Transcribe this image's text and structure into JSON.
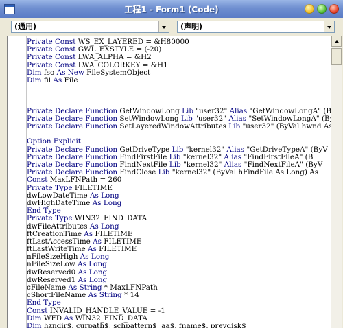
{
  "window": {
    "title": "工程1 - Form1 (Code)"
  },
  "combos": {
    "object": "(通用)",
    "procedure": "(声明)"
  },
  "code": [
    [
      {
        "t": "Private Const",
        "k": 1
      },
      {
        "t": " WS_EX_LAYERED = &H80000"
      }
    ],
    [
      {
        "t": "Private Const",
        "k": 1
      },
      {
        "t": " GWL_EXSTYLE = (-20)"
      }
    ],
    [
      {
        "t": "Private Const",
        "k": 1
      },
      {
        "t": " LWA_ALPHA = &H2"
      }
    ],
    [
      {
        "t": "Private Const",
        "k": 1
      },
      {
        "t": " LWA_COLORKEY = &H1"
      }
    ],
    [
      {
        "t": "Dim",
        "k": 1
      },
      {
        "t": " fso "
      },
      {
        "t": "As New",
        "k": 1
      },
      {
        "t": " FileSystemObject"
      }
    ],
    [
      {
        "t": "Dim",
        "k": 1
      },
      {
        "t": " fil "
      },
      {
        "t": "As",
        "k": 1
      },
      {
        "t": " File"
      }
    ],
    [],
    [],
    [],
    [
      {
        "t": "Private Declare Function",
        "k": 1
      },
      {
        "t": " GetWindowLong "
      },
      {
        "t": "Lib",
        "k": 1
      },
      {
        "t": " \"user32\" "
      },
      {
        "t": "Alias",
        "k": 1
      },
      {
        "t": " \"GetWindowLongA\" (ByV"
      }
    ],
    [
      {
        "t": "Private Declare Function",
        "k": 1
      },
      {
        "t": " SetWindowLong "
      },
      {
        "t": "Lib",
        "k": 1
      },
      {
        "t": " \"user32\" "
      },
      {
        "t": "Alias",
        "k": 1
      },
      {
        "t": " \"SetWindowLongA\" (ByV"
      }
    ],
    [
      {
        "t": "Private Declare Function",
        "k": 1
      },
      {
        "t": " SetLayeredWindowAttributes "
      },
      {
        "t": "Lib",
        "k": 1
      },
      {
        "t": " \"user32\" (ByVal hwnd As"
      }
    ],
    [],
    [
      {
        "t": "Option Explicit",
        "k": 1
      }
    ],
    [
      {
        "t": "Private Declare Function",
        "k": 1
      },
      {
        "t": " GetDriveType "
      },
      {
        "t": "Lib",
        "k": 1
      },
      {
        "t": " \"kernel32\" "
      },
      {
        "t": "Alias",
        "k": 1
      },
      {
        "t": " \"GetDriveTypeA\" (ByV"
      }
    ],
    [
      {
        "t": "Private Declare Function",
        "k": 1
      },
      {
        "t": " FindFirstFile "
      },
      {
        "t": "Lib",
        "k": 1
      },
      {
        "t": " \"kernel32\" "
      },
      {
        "t": "Alias",
        "k": 1
      },
      {
        "t": " \"FindFirstFileA\" (B"
      }
    ],
    [
      {
        "t": "Private Declare Function",
        "k": 1
      },
      {
        "t": " FindNextFile "
      },
      {
        "t": "Lib",
        "k": 1
      },
      {
        "t": " \"kernel32\" "
      },
      {
        "t": "Alias",
        "k": 1
      },
      {
        "t": " \"FindNextFileA\" (ByV"
      }
    ],
    [
      {
        "t": "Private Declare Function",
        "k": 1
      },
      {
        "t": " FindClose "
      },
      {
        "t": "Lib",
        "k": 1
      },
      {
        "t": " \"kernel32\" (ByVal hFindFile As Long) As"
      }
    ],
    [
      {
        "t": "Const",
        "k": 1
      },
      {
        "t": " MaxLFNPath = 260"
      }
    ],
    [
      {
        "t": "Private Type",
        "k": 1
      },
      {
        "t": " FILETIME"
      }
    ],
    [
      {
        "t": "dwLowDateTime "
      },
      {
        "t": "As Long",
        "k": 1
      }
    ],
    [
      {
        "t": "dwHighDateTime "
      },
      {
        "t": "As Long",
        "k": 1
      }
    ],
    [
      {
        "t": "End Type",
        "k": 1
      }
    ],
    [
      {
        "t": "Private Type",
        "k": 1
      },
      {
        "t": " WIN32_FIND_DATA"
      }
    ],
    [
      {
        "t": "dwFileAttributes "
      },
      {
        "t": "As Long",
        "k": 1
      }
    ],
    [
      {
        "t": "ftCreationTime "
      },
      {
        "t": "As",
        "k": 1
      },
      {
        "t": " FILETIME"
      }
    ],
    [
      {
        "t": "ftLastAccessTime "
      },
      {
        "t": "As",
        "k": 1
      },
      {
        "t": " FILETIME"
      }
    ],
    [
      {
        "t": "ftLastWriteTime "
      },
      {
        "t": "As",
        "k": 1
      },
      {
        "t": " FILETIME"
      }
    ],
    [
      {
        "t": "nFileSizeHigh "
      },
      {
        "t": "As Long",
        "k": 1
      }
    ],
    [
      {
        "t": "nFileSizeLow "
      },
      {
        "t": "As Long",
        "k": 1
      }
    ],
    [
      {
        "t": "dwReserved0 "
      },
      {
        "t": "As Long",
        "k": 1
      }
    ],
    [
      {
        "t": "dwReserved1 "
      },
      {
        "t": "As Long",
        "k": 1
      }
    ],
    [
      {
        "t": "cFileName "
      },
      {
        "t": "As String",
        "k": 1
      },
      {
        "t": " * MaxLFNPath"
      }
    ],
    [
      {
        "t": "cShortFileName "
      },
      {
        "t": "As String",
        "k": 1
      },
      {
        "t": " * 14"
      }
    ],
    [
      {
        "t": "End Type",
        "k": 1
      }
    ],
    [
      {
        "t": "Const",
        "k": 1
      },
      {
        "t": " INVALID_HANDLE_VALUE = -1"
      }
    ],
    [
      {
        "t": "Dim",
        "k": 1
      },
      {
        "t": " WFD "
      },
      {
        "t": "As",
        "k": 1
      },
      {
        "t": " WIN32_FIND_DATA"
      }
    ],
    [
      {
        "t": "Dim",
        "k": 1
      },
      {
        "t": " hzndir$, curpath$, schpattern$, aa$, fname$, prevdisk$"
      }
    ]
  ]
}
